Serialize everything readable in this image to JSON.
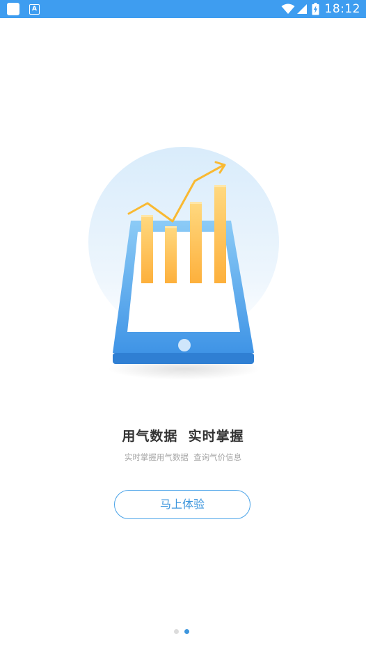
{
  "status_bar": {
    "time": "18:12",
    "background": "#3e9df0",
    "icons": [
      "notification-square-icon",
      "app-a-icon",
      "wifi-icon",
      "signal-icon",
      "battery-charging-icon"
    ]
  },
  "onboarding": {
    "headline": "用气数据  实时掌握",
    "subtitle": "实时掌握用气数据  查询气价信息",
    "cta_label": "马上体验",
    "page_count": 2,
    "active_page": 2,
    "accent_color": "#3d96dd",
    "inactive_dot_color": "#dcdcdc"
  },
  "illustration": {
    "icon": "tablet-rising-chart-illustration"
  }
}
